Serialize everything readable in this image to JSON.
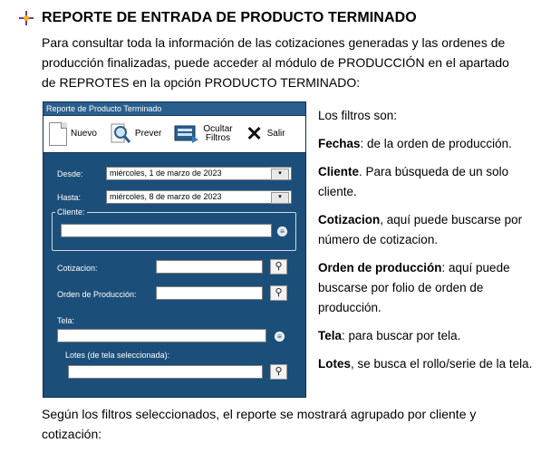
{
  "heading": "REPORTE DE ENTRADA DE PRODUCTO TERMINADO",
  "intro_lines": [
    "Para consultar toda la información de las cotizaciones generadas y las ordenes de",
    "producción finalizadas, puede acceder al módulo de PRODUCCIÓN en el apartado",
    "de REPROTES en la opción PRODUCTO TERMINADO:"
  ],
  "window": {
    "title": "Reporte de Producto Terminado",
    "toolbar": {
      "nuevo": "Nuevo",
      "prever": "Prever",
      "ocultar_line1": "Ocultar",
      "ocultar_line2": "Filtros",
      "salir": "Salir"
    },
    "desde_label": "Desde:",
    "desde_value": "miércoles,   1 de     marzo    de 2023",
    "hasta_label": "Hasta:",
    "hasta_value": "miércoles,   8 de     marzo    de 2023",
    "cliente_legend": "Cliente:",
    "cotizacion_label": "Cotizacion:",
    "orden_label": "Orden de Producción:",
    "tela_label": "Tela:",
    "lotes_label": "Lotes (de tela seleccionada):"
  },
  "filters": {
    "intro": "Los filtros son:",
    "items": [
      {
        "term": "Fechas",
        "text": ": de la orden de producción."
      },
      {
        "term": "Cliente",
        "text": ". Para búsqueda de un solo cliente."
      },
      {
        "term": "Cotizacion",
        "text": ", aquí puede buscarse por número de cotizacion."
      },
      {
        "term": "Orden de producción",
        "text": ": aquí puede buscarse por folio de orden de producción."
      },
      {
        "term": "Tela",
        "text": ": para buscar por tela."
      },
      {
        "term": "Lotes",
        "text": ", se busca el rollo/serie de la tela."
      }
    ]
  },
  "outro_lines": [
    "Según los filtros seleccionados, el reporte se mostrará agrupado por cliente y",
    "cotización:"
  ],
  "icons": {
    "bullet": "pushpin-icon",
    "nuevo": "new-document-icon",
    "prever": "preview-magnifier-icon",
    "ocultar": "hide-filters-icon",
    "salir": "close-x-icon",
    "calendar": "calendar-dropdown-icon",
    "search": "binoculars-icon",
    "select": "circle-select-icon"
  },
  "colors": {
    "panel": "#1b4f7a",
    "panel_title": "#2a5e8d"
  }
}
